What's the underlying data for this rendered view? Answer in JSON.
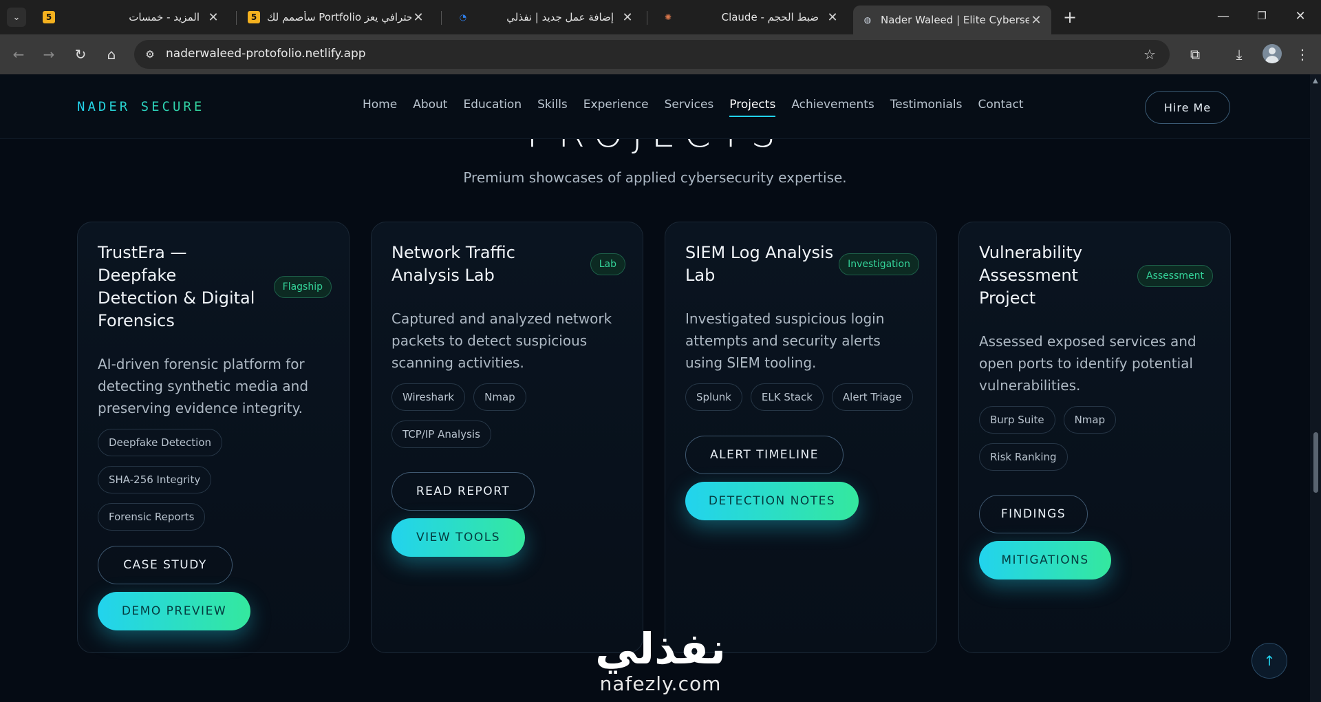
{
  "browser": {
    "tabs": [
      {
        "title": "المزيد - خمسات",
        "favicon": "5"
      },
      {
        "title": "سأصمم لك Portfolio احترافي يعز",
        "favicon": "5"
      },
      {
        "title": "إضافة عمل جديد | نفذلي",
        "favicon": "nafezly-icon"
      },
      {
        "title": "Claude - ضبط الحجم",
        "favicon": "claude-icon"
      },
      {
        "title": "Nader Waleed | Elite Cybersecu",
        "favicon": "globe-icon"
      }
    ],
    "url": "naderwaleed-protofolio.netlify.app"
  },
  "site": {
    "logo": "NADER SECURE",
    "menu": [
      "Home",
      "About",
      "Education",
      "Skills",
      "Experience",
      "Services",
      "Projects",
      "Achievements",
      "Testimonials",
      "Contact"
    ],
    "active_menu": "Projects",
    "hire_label": "Hire Me"
  },
  "section": {
    "title": "PROJECTS",
    "subtitle": "Premium showcases of applied cybersecurity expertise."
  },
  "projects": [
    {
      "title": "TrustEra — Deepfake Detection & Digital Forensics",
      "badge": "Flagship",
      "description": "AI-driven forensic platform for detecting synthetic media and preserving evidence integrity.",
      "tags": [
        "Deepfake Detection",
        "SHA-256 Integrity",
        "Forensic Reports"
      ],
      "primary_action": "CASE STUDY",
      "secondary_action": "DEMO PREVIEW"
    },
    {
      "title": "Network Traffic Analysis Lab",
      "badge": "Lab",
      "description": "Captured and analyzed network packets to detect suspicious scanning activities.",
      "tags": [
        "Wireshark",
        "Nmap",
        "TCP/IP Analysis"
      ],
      "primary_action": "READ REPORT",
      "secondary_action": "VIEW TOOLS"
    },
    {
      "title": "SIEM Log Analysis Lab",
      "badge": "Investigation",
      "description": "Investigated suspicious login attempts and security alerts using SIEM tooling.",
      "tags": [
        "Splunk",
        "ELK Stack",
        "Alert Triage"
      ],
      "primary_action": "ALERT TIMELINE",
      "secondary_action": "DETECTION NOTES"
    },
    {
      "title": "Vulnerability Assessment Project",
      "badge": "Assessment",
      "description": "Assessed exposed services and open ports to identify potential vulnerabilities.",
      "tags": [
        "Burp Suite",
        "Nmap",
        "Risk Ranking"
      ],
      "primary_action": "FINDINGS",
      "secondary_action": "MITIGATIONS"
    }
  ],
  "watermark": {
    "arabic": "نفذلي",
    "latin": "nafezly.com"
  },
  "colors": {
    "accent_cyan": "#22d3ee",
    "accent_green": "#34d399",
    "background": "#050b14"
  }
}
